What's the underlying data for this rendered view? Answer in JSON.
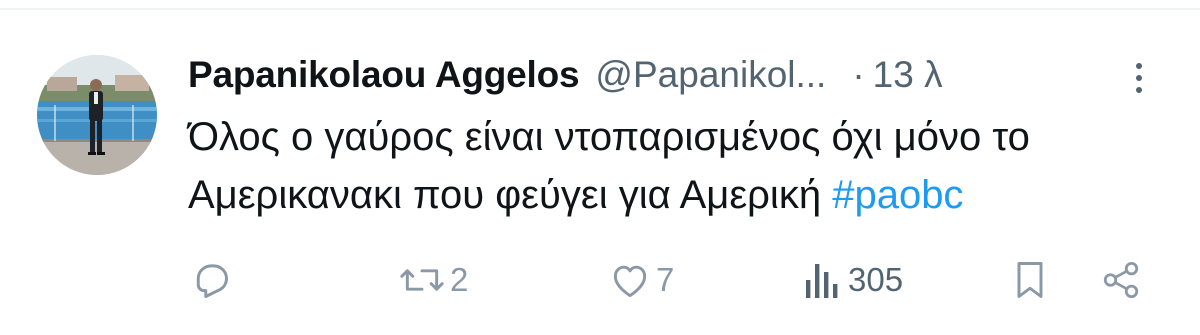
{
  "tweet": {
    "display_name": "Papanikolaou Aggelos",
    "handle": "@Papanikol...",
    "separator": "·",
    "timestamp": "13 λ",
    "text_line1": "Όλος ο γαύρος είναι ντοπαρισμένος όχι μόνο το",
    "text_line2": "Αμερικανακι που φεύγει για Αμερική",
    "hashtag": "#paobc"
  },
  "actions": {
    "reply_count": "",
    "retweet_count": "2",
    "like_count": "7",
    "views_count": "305"
  },
  "icons": {
    "reply": "reply-icon",
    "retweet": "retweet-icon",
    "like": "heart-icon",
    "views": "views-icon",
    "bookmark": "bookmark-icon",
    "share": "share-icon",
    "more": "more-icon"
  },
  "colors": {
    "hashtag": "#1d9bf0",
    "secondary_text": "#536471",
    "action_icons": "#8b98a5"
  }
}
